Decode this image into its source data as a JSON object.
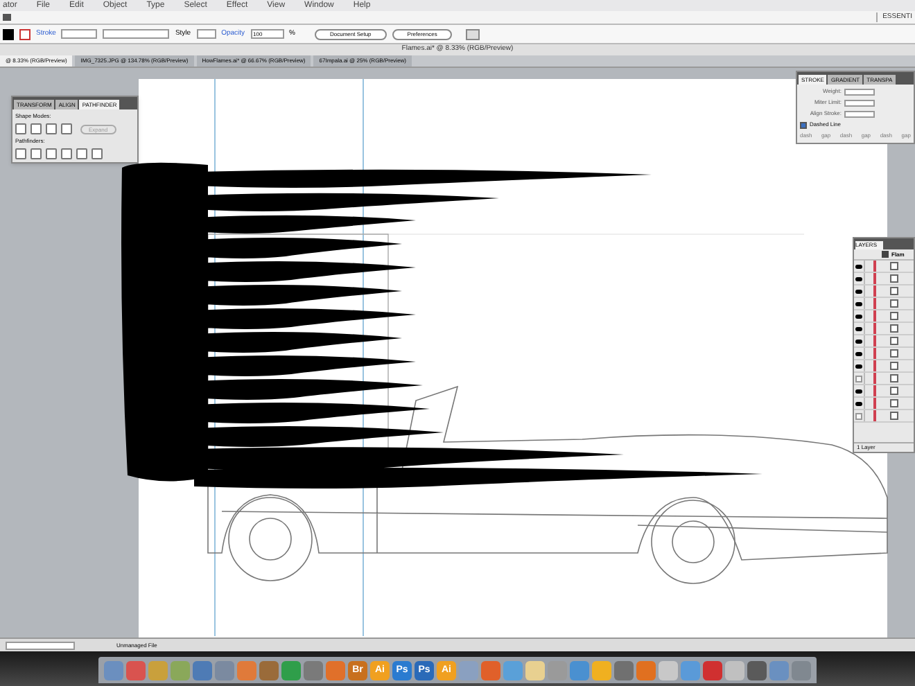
{
  "menu_bar": {
    "items": [
      "ator",
      "File",
      "Edit",
      "Object",
      "Type",
      "Select",
      "Effect",
      "View",
      "Window",
      "Help"
    ]
  },
  "workspace": "ESSENTI",
  "control_bar": {
    "stroke_label": "Stroke",
    "style_label": "Style",
    "opacity_label": "Opacity",
    "opacity": "100",
    "opacity_unit": "%",
    "buttons": [
      "Document Setup",
      "Preferences"
    ]
  },
  "document_title": "Flames.ai* @ 8.33% (RGB/Preview)",
  "tabs": [
    {
      "label": "@ 8.33% (RGB/Preview)",
      "selected": true
    },
    {
      "label": "IMG_7325.JPG @ 134.78% (RGB/Preview)",
      "selected": false
    },
    {
      "label": "HowFlames.ai* @ 66.67% (RGB/Preview)",
      "selected": false
    },
    {
      "label": "67Impala.ai @ 25% (RGB/Preview)",
      "selected": false
    }
  ],
  "pathfinder_panel": {
    "tabs": [
      {
        "label": "TRANSFORM",
        "selected": false
      },
      {
        "label": "ALIGN",
        "selected": false
      },
      {
        "label": "PATHFINDER",
        "selected": true
      }
    ],
    "shape_modes_label": "Shape Modes:",
    "expand_button": "Expand",
    "pathfinders_label": "Pathfinders:"
  },
  "stroke_panel": {
    "tabs": [
      {
        "label": "STROKE",
        "selected": true
      },
      {
        "label": "GRADIENT",
        "selected": false
      },
      {
        "label": "TRANSPA",
        "selected": false
      }
    ],
    "weight_label": "Weight:",
    "miter_label": "Miter Limit:",
    "align_label": "Align Stroke:",
    "dashed_line": {
      "label": "Dashed Line",
      "checked": true
    },
    "dash_fields": [
      "dash",
      "gap",
      "dash",
      "gap",
      "dash",
      "gap"
    ]
  },
  "layers_panel": {
    "title": "LAYERS",
    "top_layer": "Flam",
    "rows": [
      {
        "visible": true
      },
      {
        "visible": true
      },
      {
        "visible": true
      },
      {
        "visible": true
      },
      {
        "visible": true
      },
      {
        "visible": true
      },
      {
        "visible": true
      },
      {
        "visible": true
      },
      {
        "visible": true
      },
      {
        "visible": false
      },
      {
        "visible": true
      },
      {
        "visible": true
      },
      {
        "visible": false
      }
    ],
    "footer": "1 Layer"
  },
  "status_bar": {
    "file_status": "Unmanaged File"
  },
  "dock": [
    {
      "color": "#6b8fbf"
    },
    {
      "color": "#d9534f"
    },
    {
      "color": "#c9a03c"
    },
    {
      "color": "#8aa85a"
    },
    {
      "color": "#4e7bb5"
    },
    {
      "color": "#7b8aa0"
    },
    {
      "color": "#e07a3a"
    },
    {
      "color": "#9a6b3a"
    },
    {
      "color": "#2f9e4a"
    },
    {
      "color": "#7a7a7a"
    },
    {
      "color": "#e0702a"
    },
    {
      "color": "#c8701e",
      "label": "Br"
    },
    {
      "color": "#f0a020",
      "label": "Ai"
    },
    {
      "color": "#2a7bd0",
      "label": "Ps"
    },
    {
      "color": "#2a6ab8",
      "label": "Ps"
    },
    {
      "color": "#f0a020",
      "label": "Ai"
    },
    {
      "color": "#8aa0c0"
    },
    {
      "color": "#e0602a"
    },
    {
      "color": "#5aa0d8"
    },
    {
      "color": "#e8d090"
    },
    {
      "color": "#9a9a9a"
    },
    {
      "color": "#4a90d0"
    },
    {
      "color": "#f0b020"
    },
    {
      "color": "#707070"
    },
    {
      "color": "#e07020"
    },
    {
      "color": "#c8c8c8"
    },
    {
      "color": "#5a9ad8"
    },
    {
      "color": "#d03030"
    },
    {
      "color": "#c0c0c0"
    },
    {
      "color": "#5a5a5a"
    },
    {
      "color": "#6a90c0"
    },
    {
      "color": "#808890"
    }
  ]
}
